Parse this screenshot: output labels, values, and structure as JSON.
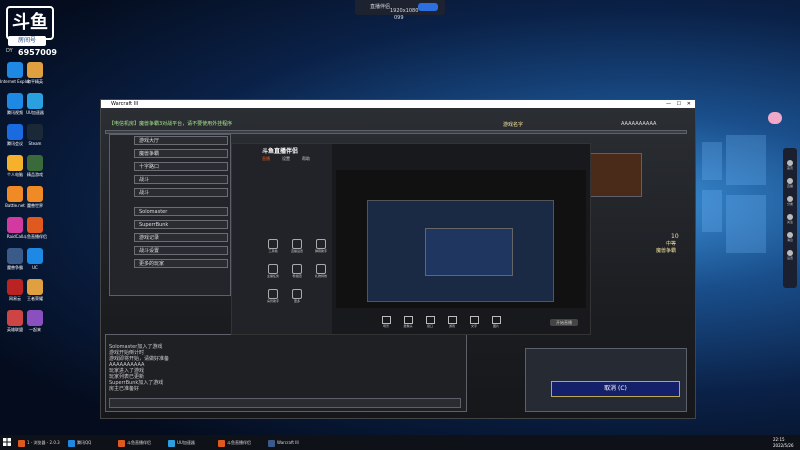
{
  "overlay": {
    "logo_glyph": "斗鱼",
    "badge_label": "房间号",
    "room_prefix": "DY",
    "room_number": "6957009"
  },
  "desktop_icons": [
    {
      "label": "Internet Explorer",
      "color": "#1e88e5"
    },
    {
      "label": "和平精英",
      "color": "#e0a040"
    },
    {
      "label": "腾讯视频",
      "color": "#1e88e5"
    },
    {
      "label": "UU加速器",
      "color": "#2aa0e0"
    },
    {
      "label": "腾讯会议",
      "color": "#1a6ae0"
    },
    {
      "label": "Steam",
      "color": "#1b2838"
    },
    {
      "label": "个人电脑",
      "color": "#f5b12b"
    },
    {
      "label": "精品游戏",
      "color": "#3a6a3a"
    },
    {
      "label": "Battle.net",
      "color": "#f08a24"
    },
    {
      "label": "魔兽世界",
      "color": "#f08a24"
    },
    {
      "label": "RaidCall",
      "color": "#d23aa0"
    },
    {
      "label": "斗鱼直播伴侣",
      "color": "#e05a20"
    },
    {
      "label": "魔兽争霸",
      "color": "#3a5a8a"
    },
    {
      "label": "UC",
      "color": "#1e88e5"
    },
    {
      "label": "网易云",
      "color": "#b22"
    },
    {
      "label": "王者荣耀",
      "color": "#e0a040"
    },
    {
      "label": "英雄联盟",
      "color": "#c44"
    },
    {
      "label": "一起来",
      "color": "#8a50c0"
    }
  ],
  "top_bar": {
    "title": "直播伴侣",
    "text1": "1920x1080",
    "text2": "099"
  },
  "window": {
    "title": "Warcraft III",
    "header_text": "【电信机房】魔兽争霸3对战平台，请不要使用外挂程序",
    "top_right_label": "AAAAAAAAAA",
    "game_label": "游戏名字",
    "menu": [
      "游戏大厅",
      "魔兽争霸",
      "十字路口",
      "战斗",
      "战斗",
      "Solomaster",
      "SuperrBunk",
      "游戏记录",
      "战斗设置",
      "更多的玩家"
    ],
    "chat": [
      "Solomaster加入了游戏",
      "游戏开始倒计时",
      "游戏即将开始，请做好准备",
      "AAAAAAAAAA",
      "玩家进入了游戏",
      "玩家列表已更新",
      "SuperrBunk加入了游戏",
      "房主已准备好"
    ],
    "score_line1": "10",
    "score_line2": "中等",
    "score_line3": "魔兽争霸",
    "confirm_button": "取消 (C)"
  },
  "app": {
    "title": "斗鱼直播伴侣",
    "tab1": "直播",
    "tab2": "设置",
    "tab3": "帮助",
    "side_labels": [
      "工具箱",
      "直播设置",
      "弹幕助手",
      "主播任务",
      "粉丝团",
      "礼物特效",
      "房管助手",
      "更多"
    ],
    "bottom_buttons": [
      "场景",
      "摄像头",
      "窗口",
      "游戏",
      "文字",
      "图片"
    ],
    "start_button": "开始直播"
  },
  "right_panel": [
    "首页",
    "直播",
    "分类",
    "关注",
    "消息",
    "设置"
  ],
  "taskbar": {
    "items": [
      "1 - 浏览器 - 2.0.3",
      "腾讯QQ",
      "斗鱼直播伴侣",
      "UU加速器",
      "斗鱼直播伴侣",
      "Warcraft III"
    ],
    "time": "22:15",
    "date": "2022/5/26"
  }
}
